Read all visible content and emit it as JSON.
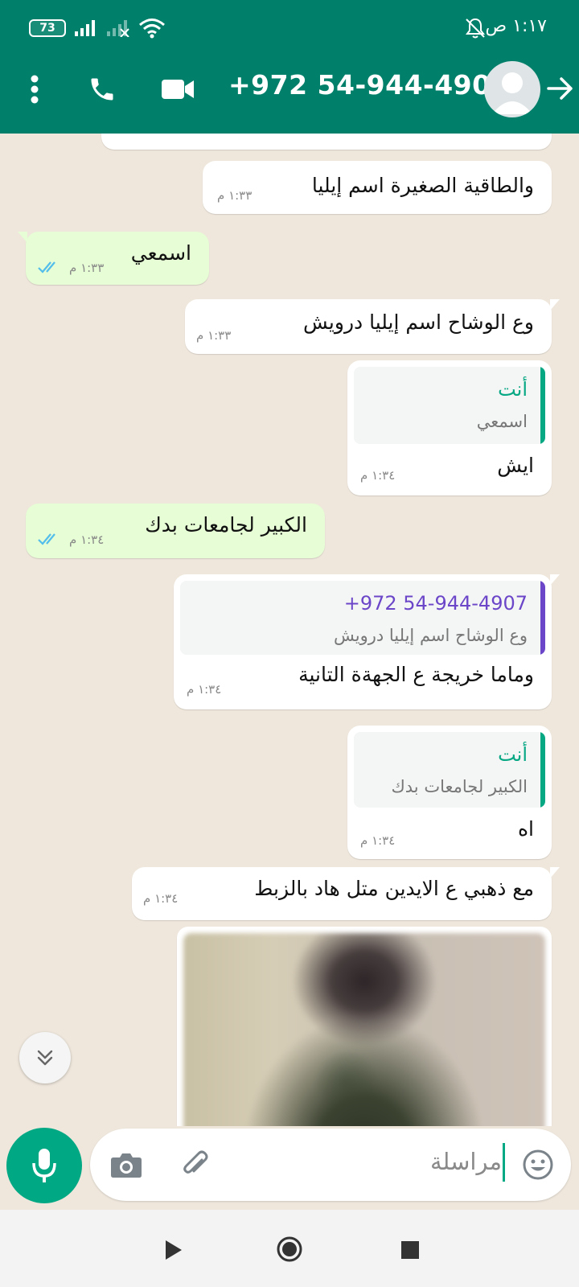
{
  "status_bar": {
    "time": "١:١٧ ص",
    "battery": "73"
  },
  "header": {
    "contact_name": "+972 54-944-4907"
  },
  "messages": [
    {
      "direction": "incoming",
      "text": "والطاقية الصغيرة اسم إيليا",
      "time": "١:٣٣ م"
    },
    {
      "direction": "outgoing",
      "text": "اسمعي",
      "time": "١:٣٣ م",
      "status": "read"
    },
    {
      "direction": "incoming",
      "text": "وع الوشاح اسم إيليا درويش",
      "time": "١:٣٣ م"
    },
    {
      "direction": "incoming",
      "quote_author": "أنت",
      "quote_text": "اسمعي",
      "text": "ايش",
      "time": "١:٣٤ م"
    },
    {
      "direction": "outgoing",
      "text": "الكبير لجامعات بدك",
      "time": "١:٣٤ م",
      "status": "read"
    },
    {
      "direction": "incoming",
      "quote_author": "+972 54-944-4907",
      "quote_text": "وع الوشاح اسم إيليا درويش",
      "text": "وماما خريجة ع الجهةة التانية",
      "time": "١:٣٤ م"
    },
    {
      "direction": "incoming",
      "quote_author": "أنت",
      "quote_text": "الكبير لجامعات بدك",
      "text": "اه",
      "time": "١:٣٤ م"
    },
    {
      "direction": "incoming",
      "text": "مع ذهبي ع الايدين متل هاد بالزبط",
      "time": "١:٣٤ م"
    }
  ],
  "composer": {
    "placeholder": "مراسلة"
  },
  "colors": {
    "header": "#00806a",
    "accent": "#00a884",
    "outgoing_bubble": "#e6fdd5",
    "incoming_bubble": "#ffffff",
    "quote_self": "#06a884",
    "quote_contact": "#6b46c8",
    "read_ticks": "#53bdeb"
  }
}
